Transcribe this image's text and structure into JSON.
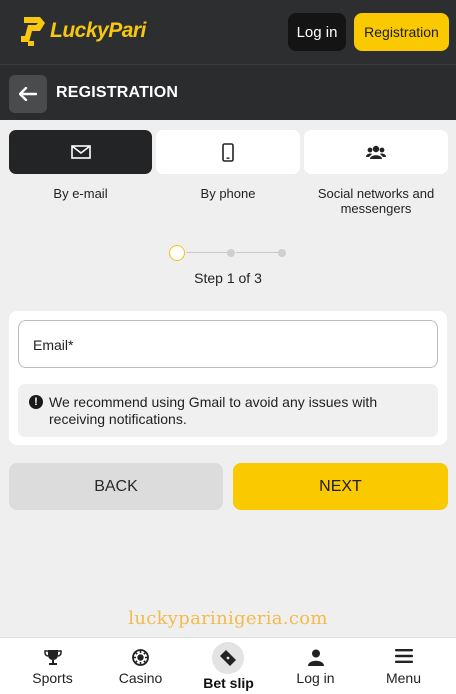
{
  "header": {
    "logo_text": "LuckyPari",
    "login_label": "Log in",
    "register_label": "Registration"
  },
  "subheader": {
    "title": "REGISTRATION"
  },
  "reg_tabs": [
    {
      "label": "By e-mail",
      "icon": "envelope-icon",
      "active": true
    },
    {
      "label": "By phone",
      "icon": "phone-icon",
      "active": false
    },
    {
      "label": "Social networks and messengers",
      "icon": "users-icon",
      "active": false
    }
  ],
  "stepper": {
    "current": 1,
    "total": 3,
    "label": "Step 1 of 3"
  },
  "form": {
    "email_label": "Email*",
    "notice": "We recommend using Gmail to avoid any issues with receiving notifications."
  },
  "actions": {
    "back_label": "BACK",
    "next_label": "NEXT"
  },
  "watermark": "luckyparinigeria.com",
  "bottom_nav": [
    {
      "label": "Sports",
      "icon": "trophy-icon"
    },
    {
      "label": "Casino",
      "icon": "poker-chip-icon"
    },
    {
      "label": "Bet slip",
      "icon": "ticket-icon"
    },
    {
      "label": "Log in",
      "icon": "user-icon"
    },
    {
      "label": "Menu",
      "icon": "hamburger-icon"
    }
  ],
  "colors": {
    "brand_yellow": "#fbc900",
    "header_dark": "#2d2e30",
    "active_tab": "#232425",
    "background": "#efefef"
  }
}
